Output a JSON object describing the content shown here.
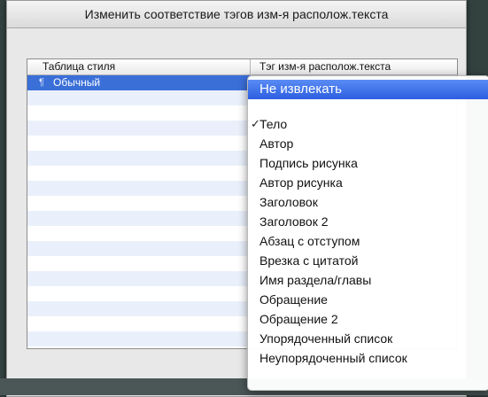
{
  "dialog": {
    "title": "Изменить соответствие тэгов изм-я располож.текста"
  },
  "table": {
    "columns": [
      "Таблица стиля",
      "Тэг изм-я располож.текста"
    ],
    "rows": [
      {
        "style": "Обычный",
        "icon": "paragraph-style-icon"
      }
    ]
  },
  "popup": {
    "items": [
      {
        "label": "Не извлекать",
        "highlighted": true,
        "checked": false
      },
      {
        "label": "Тело",
        "highlighted": false,
        "checked": true
      },
      {
        "label": "Автор",
        "highlighted": false,
        "checked": false
      },
      {
        "label": "Подпись рисунка",
        "highlighted": false,
        "checked": false
      },
      {
        "label": "Автор рисунка",
        "highlighted": false,
        "checked": false
      },
      {
        "label": "Заголовок",
        "highlighted": false,
        "checked": false
      },
      {
        "label": "Заголовок 2",
        "highlighted": false,
        "checked": false
      },
      {
        "label": "Абзац с отступом",
        "highlighted": false,
        "checked": false
      },
      {
        "label": "Врезка с цитатой",
        "highlighted": false,
        "checked": false
      },
      {
        "label": "Имя раздела/главы",
        "highlighted": false,
        "checked": false
      },
      {
        "label": "Обращение",
        "highlighted": false,
        "checked": false
      },
      {
        "label": "Обращение 2",
        "highlighted": false,
        "checked": false
      },
      {
        "label": "Упорядоченный список",
        "highlighted": false,
        "checked": false
      },
      {
        "label": "Неупорядоченный список",
        "highlighted": false,
        "checked": false
      }
    ],
    "check_glyph": "✓"
  },
  "colors": {
    "selection": "#3a6fd8",
    "menu_highlight": "#2d5ee0"
  }
}
